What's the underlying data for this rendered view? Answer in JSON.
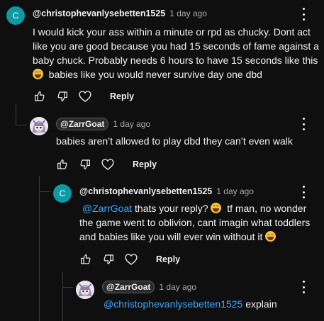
{
  "comments": [
    {
      "author": "@christophevanlysebetten1525",
      "avatar_letter": "C",
      "time": "1 day ago",
      "text_lines": [
        "I would kick your ass within a minute or rpd as chucky. Dont act",
        "like you are good because you had 15 seconds of fame against a",
        "baby chuck. Probably needs 6 hours to have 15 seconds like this",
        "babies like you would never survive day one dbd"
      ],
      "reply_label": "Reply"
    },
    {
      "author": "@ZarrGoat",
      "time": "1 day ago",
      "text_lines": [
        "babies aren’t allowed to play dbd they can’t even walk"
      ],
      "reply_label": "Reply"
    },
    {
      "author": "@christophevanlysebetten1525",
      "avatar_letter": "C",
      "time": "1 day ago",
      "mention": "@ZarrGoat",
      "text_lines": [
        "thats your reply?",
        "tf man, no wonder",
        "the game went to oblivion, cant imagin what toddlers",
        "and babies like you will ever win without it"
      ],
      "reply_label": "Reply"
    },
    {
      "author": "@ZarrGoat",
      "time": "1 day ago",
      "mention": "@christophevanlysebetten1525",
      "text_lines": [
        "explain"
      ]
    }
  ],
  "icons": {
    "like": "thumbs-up-icon",
    "dislike": "thumbs-down-icon",
    "heart": "heart-icon",
    "more": "more-vert-icon",
    "emoji": "grinning-sweat-emoji"
  },
  "colors": {
    "background": "#0f0f0f",
    "text": "#f1f1f1",
    "secondary": "#aaaaaa",
    "link": "#3ea6ff",
    "avatar_teal": "#0c9aa6"
  }
}
